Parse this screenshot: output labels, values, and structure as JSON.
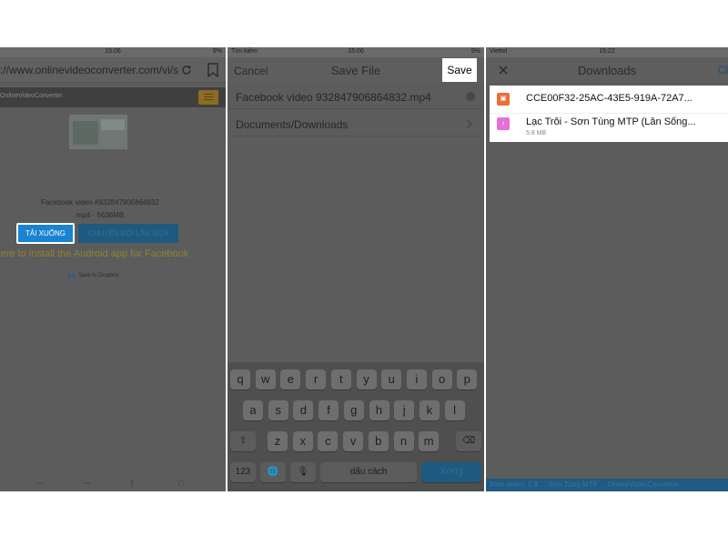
{
  "panel1": {
    "status": {
      "carrier": "",
      "time": "15:06",
      "battery": "9%"
    },
    "url": "://www.onlinevideoconverter.com/vi/s...",
    "site_logo": "OnlineVideoConverter",
    "video": {
      "filename": "Facebook video #932847906864832",
      "format_size": "mp4 · 5636MB"
    },
    "download_button": "TẢI XUỐNG",
    "convert_again_button": "CHUYỂN ĐỔI LẦN NỮA",
    "android_link": "k here to install the Android app for Facebook",
    "dropbox_label": "Save to Dropbox"
  },
  "panel2": {
    "status": {
      "carrier": "Tìm kiếm",
      "time": "15:06",
      "battery": "9%"
    },
    "cancel_label": "Cancel",
    "title": "Save File",
    "save_label": "Save",
    "filename": "Facebook video 932847906864832.mp4",
    "folder": "Documents/Downloads",
    "keyboard": {
      "row1": [
        "q",
        "w",
        "e",
        "r",
        "t",
        "y",
        "u",
        "i",
        "o",
        "p"
      ],
      "row2": [
        "a",
        "s",
        "d",
        "f",
        "g",
        "h",
        "j",
        "k",
        "l"
      ],
      "row3": [
        "z",
        "x",
        "c",
        "v",
        "b",
        "n",
        "m"
      ],
      "shift_icon": "⇧",
      "delete_icon": "⌫",
      "numbers_label": "123",
      "globe_icon": "🌐",
      "mic_icon": "🎙",
      "space_label": "dấu cách",
      "done_label": "Xong"
    }
  },
  "panel3": {
    "status": {
      "carrier": "Viettel",
      "time": "15:22",
      "battery": ""
    },
    "close_icon": "×",
    "title": "Downloads",
    "clear_label": "Cl",
    "items": [
      {
        "name": "CCE00F32-25AC-43E5-919A-72A7...",
        "size": "",
        "icon": "file-icon-orange"
      },
      {
        "name": "Lạc Trôi - Sơn Tùng MTP (Lân Sống...",
        "size": "5.8 MB",
        "icon": "music-icon-pink"
      }
    ],
    "banner": "Xem video, 5.8 ... Sơn Tùng MTP ... OnlineVideoConverter"
  },
  "colors": {
    "overlay": "#5c5c5c",
    "primary_button": "#1a82d2",
    "save_button_bg": "#ffffff",
    "orange_icon": "#e8703a",
    "pink_icon": "#e66fd9"
  }
}
